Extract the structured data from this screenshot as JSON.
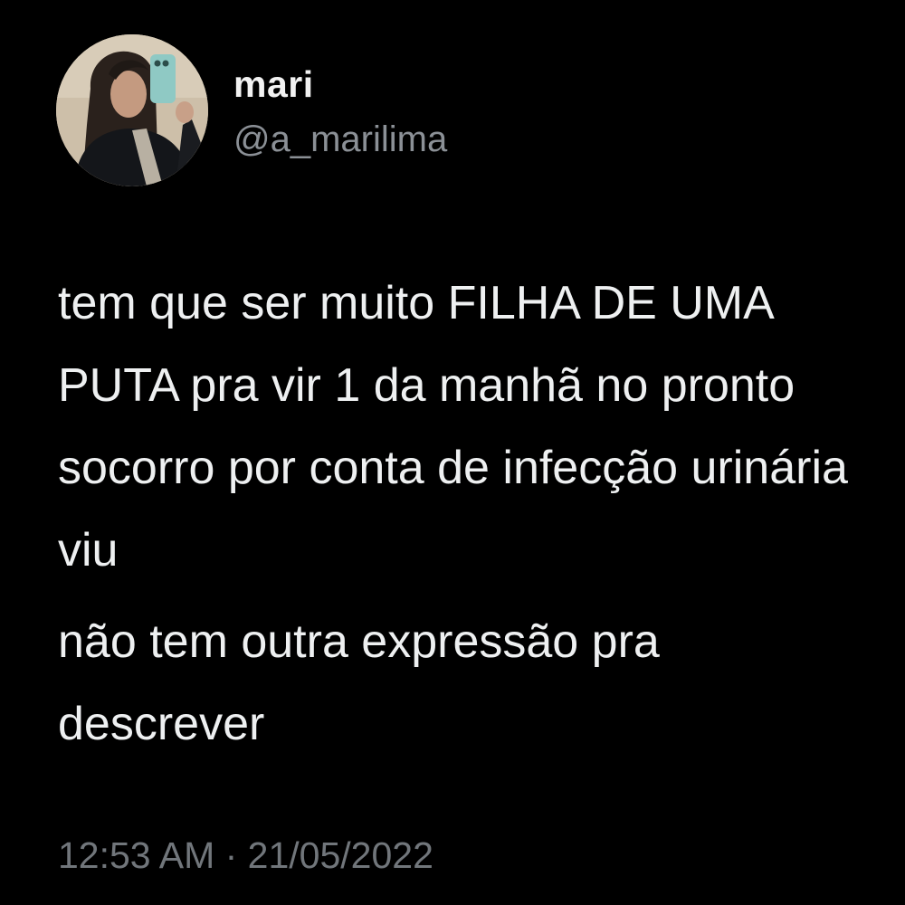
{
  "author": {
    "name": "mari",
    "handle": "@a_marilima",
    "avatar_icon": "profile-photo"
  },
  "tweet": {
    "paragraphs": [
      [
        "tem que ser muito FILHA DE UMA",
        "PUTA pra vir 1 da manhã no pronto",
        "socorro por conta de infecção urinária",
        "viu"
      ],
      [
        "não tem outra expressão pra",
        "descrever"
      ]
    ],
    "timestamp": "12:53 AM · 21/05/2022"
  },
  "colors": {
    "background": "#000000",
    "text": "#e7e9ea",
    "secondary_text": "#71767b"
  }
}
